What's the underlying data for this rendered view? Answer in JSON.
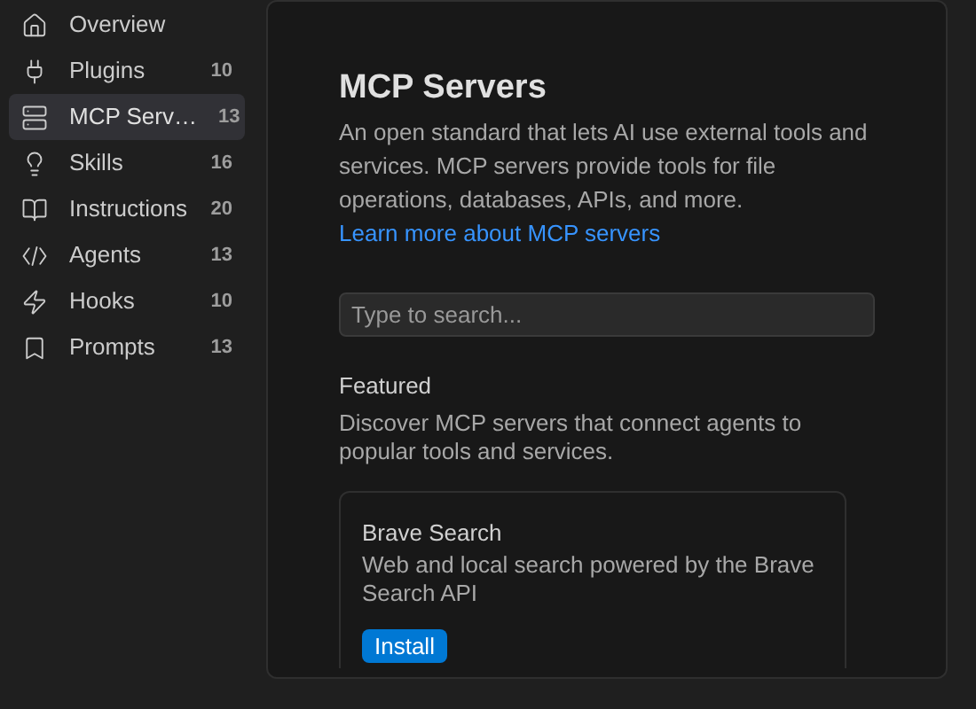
{
  "sidebar": {
    "items": [
      {
        "label": "Overview",
        "kind": "overview",
        "selected": false
      },
      {
        "label": "Plugins",
        "kind": "plugins",
        "count": "10",
        "selected": false
      },
      {
        "label": "MCP Serv…",
        "kind": "servers",
        "count": "13",
        "selected": true
      },
      {
        "label": "Skills",
        "kind": "skills",
        "count": "16",
        "selected": false
      },
      {
        "label": "Instructions",
        "kind": "instructions",
        "count": "20",
        "selected": false
      },
      {
        "label": "Agents",
        "kind": "agents",
        "count": "13",
        "selected": false
      },
      {
        "label": "Hooks",
        "kind": "hooks",
        "count": "10",
        "selected": false
      },
      {
        "label": "Prompts",
        "kind": "prompts",
        "count": "13",
        "selected": false
      }
    ]
  },
  "main": {
    "title": "MCP Servers",
    "description": "An open standard that lets AI use external tools and services. MCP servers provide tools for file operations, databases, APIs, and more.",
    "link": "Learn more about MCP servers",
    "search": {
      "placeholder": "Type to search..."
    },
    "featured": {
      "title": "Featured",
      "description": "Discover MCP servers that connect agents to popular tools and services.",
      "cards": [
        {
          "name": "Brave Search",
          "description": "Web and local search powered by the Brave Search API",
          "button": "Install"
        }
      ]
    }
  }
}
